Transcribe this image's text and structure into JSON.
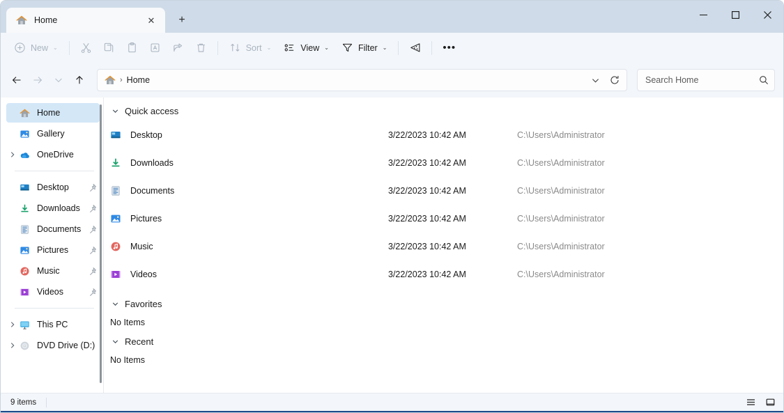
{
  "window": {
    "tab_title": "Home",
    "tab_close_label": "✕",
    "new_tab_label": "+",
    "minimize_label": "minimize",
    "maximize_label": "maximize",
    "close_label": "close"
  },
  "toolbar": {
    "new_label": "New",
    "cut_label": "Cut",
    "copy_label": "Copy",
    "paste_label": "Paste",
    "rename_label": "Rename",
    "share_label": "Share",
    "delete_label": "Delete",
    "sort_label": "Sort",
    "view_label": "View",
    "filter_label": "Filter",
    "details_pane_label": "Details",
    "more_label": "•••",
    "chevron": "⌄"
  },
  "navbar": {
    "back_label": "←",
    "forward_label": "→",
    "recent_label": "⌄",
    "up_label": "↑",
    "breadcrumb_root_icon": "home-icon",
    "breadcrumb_separator": "›",
    "breadcrumb_text": "Home",
    "address_dropdown": "⌄",
    "refresh_label": "refresh"
  },
  "search": {
    "placeholder": "Search Home",
    "value": "",
    "icon": "search-icon"
  },
  "sidebar": {
    "items": [
      {
        "label": "Home",
        "icon": "home-icon",
        "selected": true,
        "twisty": false,
        "pin": false
      },
      {
        "label": "Gallery",
        "icon": "gallery-icon",
        "selected": false,
        "twisty": false,
        "pin": false
      },
      {
        "label": "OneDrive",
        "icon": "onedrive-icon",
        "selected": false,
        "twisty": true,
        "pin": false
      }
    ],
    "pinned": [
      {
        "label": "Desktop",
        "icon": "desktop-icon",
        "pin": true
      },
      {
        "label": "Downloads",
        "icon": "downloads-icon",
        "pin": true
      },
      {
        "label": "Documents",
        "icon": "documents-icon",
        "pin": true
      },
      {
        "label": "Pictures",
        "icon": "pictures-icon",
        "pin": true
      },
      {
        "label": "Music",
        "icon": "music-icon",
        "pin": true
      },
      {
        "label": "Videos",
        "icon": "videos-icon",
        "pin": true
      }
    ],
    "drives": [
      {
        "label": "This PC",
        "icon": "thispc-icon",
        "twisty": true
      },
      {
        "label": "DVD Drive (D:) V",
        "icon": "dvd-icon",
        "twisty": true
      }
    ]
  },
  "main": {
    "groups": [
      {
        "title": "Quick access",
        "expanded": true,
        "rows": [
          {
            "name": "Desktop",
            "icon": "desktop-icon",
            "date": "3/22/2023 10:42 AM",
            "path": "C:\\Users\\Administrator"
          },
          {
            "name": "Downloads",
            "icon": "downloads-icon",
            "date": "3/22/2023 10:42 AM",
            "path": "C:\\Users\\Administrator"
          },
          {
            "name": "Documents",
            "icon": "documents-icon",
            "date": "3/22/2023 10:42 AM",
            "path": "C:\\Users\\Administrator"
          },
          {
            "name": "Pictures",
            "icon": "pictures-icon",
            "date": "3/22/2023 10:42 AM",
            "path": "C:\\Users\\Administrator"
          },
          {
            "name": "Music",
            "icon": "music-icon",
            "date": "3/22/2023 10:42 AM",
            "path": "C:\\Users\\Administrator"
          },
          {
            "name": "Videos",
            "icon": "videos-icon",
            "date": "3/22/2023 10:42 AM",
            "path": "C:\\Users\\Administrator"
          }
        ],
        "empty_text": ""
      },
      {
        "title": "Favorites",
        "expanded": true,
        "rows": [],
        "empty_text": "No Items"
      },
      {
        "title": "Recent",
        "expanded": true,
        "rows": [],
        "empty_text": "No Items"
      }
    ]
  },
  "statusbar": {
    "item_count": "9 items",
    "details_view_label": "details-view",
    "icons_view_label": "large-icons-view"
  },
  "colors": {
    "titlebar": "#cfdbe8",
    "toolbar": "#f3f6fa",
    "selection": "#d3e7f7",
    "accent": "#1a4a8a",
    "muted_text": "#8a8a8a",
    "disabled_text": "#a9b4c0"
  }
}
